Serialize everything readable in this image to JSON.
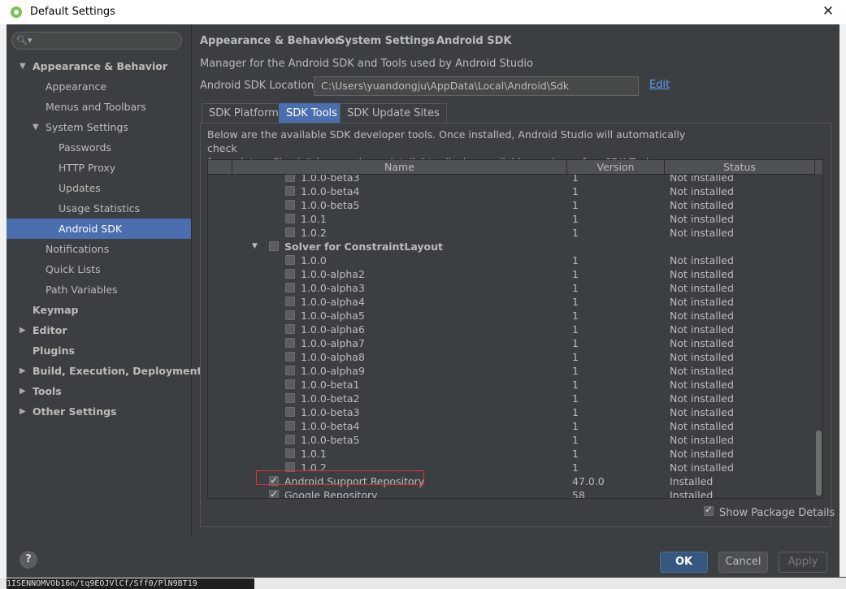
{
  "window": {
    "title": "Default Settings",
    "close_glyph": "✕"
  },
  "sidebar": {
    "search_placeholder": "",
    "items": [
      {
        "label": "Appearance & Behavior",
        "level": 0,
        "bold": true,
        "arrow": "▼"
      },
      {
        "label": "Appearance",
        "level": 1
      },
      {
        "label": "Menus and Toolbars",
        "level": 1
      },
      {
        "label": "System Settings",
        "level": 1,
        "arrow": "▼"
      },
      {
        "label": "Passwords",
        "level": 2
      },
      {
        "label": "HTTP Proxy",
        "level": 2
      },
      {
        "label": "Updates",
        "level": 2
      },
      {
        "label": "Usage Statistics",
        "level": 2
      },
      {
        "label": "Android SDK",
        "level": 2,
        "selected": true
      },
      {
        "label": "Notifications",
        "level": 1
      },
      {
        "label": "Quick Lists",
        "level": 1
      },
      {
        "label": "Path Variables",
        "level": 1
      },
      {
        "label": "Keymap",
        "level": 0,
        "bold": true
      },
      {
        "label": "Editor",
        "level": 0,
        "bold": true,
        "arrow": "▶"
      },
      {
        "label": "Plugins",
        "level": 0,
        "bold": true
      },
      {
        "label": "Build, Execution, Deployment",
        "level": 0,
        "bold": true,
        "arrow": "▶"
      },
      {
        "label": "Tools",
        "level": 0,
        "bold": true,
        "arrow": "▶"
      },
      {
        "label": "Other Settings",
        "level": 0,
        "bold": true,
        "arrow": "▶"
      }
    ]
  },
  "breadcrumb": {
    "part1": "Appearance & Behavior",
    "sep": "›",
    "part2": "System Settings",
    "part3": "Android SDK"
  },
  "description": "Manager for the Android SDK and Tools used by Android Studio",
  "sdk_location": {
    "label": "Android SDK Location:",
    "value": "C:\\Users\\yuandongju\\AppData\\Local\\Android\\Sdk",
    "edit_label": "Edit"
  },
  "tabs": {
    "platforms": "SDK Platforms",
    "tools": "SDK Tools",
    "sites": "SDK Update Sites"
  },
  "panel_description_line1": "Below are the available SDK developer tools. Once installed, Android Studio will automatically check",
  "panel_description_line2": "for updates. Check \"show package details\" to display available versions of an SDK Tool.",
  "table": {
    "columns": {
      "name": "Name",
      "version": "Version",
      "status": "Status"
    },
    "rows": [
      {
        "name": "1.0.0-beta3",
        "version": "1",
        "status": "Not installed",
        "indent": 2,
        "checked": false
      },
      {
        "name": "1.0.0-beta4",
        "version": "1",
        "status": "Not installed",
        "indent": 2,
        "checked": false
      },
      {
        "name": "1.0.0-beta5",
        "version": "1",
        "status": "Not installed",
        "indent": 2,
        "checked": false
      },
      {
        "name": "1.0.1",
        "version": "1",
        "status": "Not installed",
        "indent": 2,
        "checked": false
      },
      {
        "name": "1.0.2",
        "version": "1",
        "status": "Not installed",
        "indent": 2,
        "checked": false
      },
      {
        "name": "Solver for ConstraintLayout",
        "version": "",
        "status": "",
        "indent": 1,
        "checked": false,
        "group": true
      },
      {
        "name": "1.0.0",
        "version": "1",
        "status": "Not installed",
        "indent": 2,
        "checked": false
      },
      {
        "name": "1.0.0-alpha2",
        "version": "1",
        "status": "Not installed",
        "indent": 2,
        "checked": false
      },
      {
        "name": "1.0.0-alpha3",
        "version": "1",
        "status": "Not installed",
        "indent": 2,
        "checked": false
      },
      {
        "name": "1.0.0-alpha4",
        "version": "1",
        "status": "Not installed",
        "indent": 2,
        "checked": false
      },
      {
        "name": "1.0.0-alpha5",
        "version": "1",
        "status": "Not installed",
        "indent": 2,
        "checked": false
      },
      {
        "name": "1.0.0-alpha6",
        "version": "1",
        "status": "Not installed",
        "indent": 2,
        "checked": false
      },
      {
        "name": "1.0.0-alpha7",
        "version": "1",
        "status": "Not installed",
        "indent": 2,
        "checked": false
      },
      {
        "name": "1.0.0-alpha8",
        "version": "1",
        "status": "Not installed",
        "indent": 2,
        "checked": false
      },
      {
        "name": "1.0.0-alpha9",
        "version": "1",
        "status": "Not installed",
        "indent": 2,
        "checked": false
      },
      {
        "name": "1.0.0-beta1",
        "version": "1",
        "status": "Not installed",
        "indent": 2,
        "checked": false
      },
      {
        "name": "1.0.0-beta2",
        "version": "1",
        "status": "Not installed",
        "indent": 2,
        "checked": false
      },
      {
        "name": "1.0.0-beta3",
        "version": "1",
        "status": "Not installed",
        "indent": 2,
        "checked": false
      },
      {
        "name": "1.0.0-beta4",
        "version": "1",
        "status": "Not installed",
        "indent": 2,
        "checked": false
      },
      {
        "name": "1.0.0-beta5",
        "version": "1",
        "status": "Not installed",
        "indent": 2,
        "checked": false
      },
      {
        "name": "1.0.1",
        "version": "1",
        "status": "Not installed",
        "indent": 2,
        "checked": false
      },
      {
        "name": "1.0.2",
        "version": "1",
        "status": "Not installed",
        "indent": 2,
        "checked": false
      },
      {
        "name": "Android Support Repository",
        "version": "47.0.0",
        "status": "Installed",
        "indent": 1,
        "checked": true
      },
      {
        "name": "Google Repository",
        "version": "58",
        "status": "Installed",
        "indent": 1,
        "checked": true
      }
    ]
  },
  "show_package_details": {
    "label": "Show Package Details",
    "checked": true
  },
  "buttons": {
    "ok": "OK",
    "cancel": "Cancel",
    "apply": "Apply"
  },
  "help_glyph": "?",
  "background_strip_text": "1ISENNOMVOb16n/tq9EOJVlCf/Sff0/PlN9BT19"
}
